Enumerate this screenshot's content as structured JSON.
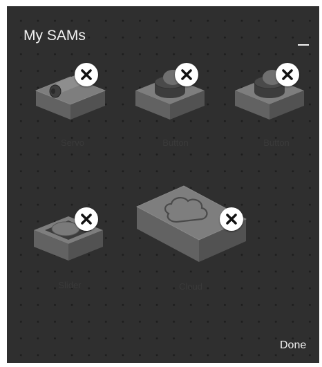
{
  "header": {
    "title": "My SAMs"
  },
  "actions": {
    "done_label": "Done"
  },
  "blocks": [
    {
      "label": "Servo",
      "icon": "servo-motor-icon"
    },
    {
      "label": "Button",
      "icon": "button-icon"
    },
    {
      "label": "Button",
      "icon": "button-icon"
    },
    {
      "label": "Slider",
      "icon": "button-icon"
    },
    {
      "label": "Cloud",
      "icon": "cloud-icon"
    }
  ],
  "colors": {
    "panel_bg": "#2f2f2f",
    "grid_dot": "#1d1d1d",
    "block_top": "#7a7a7a",
    "block_side": "#5c5c5c",
    "close_bg": "#ffffff",
    "close_x": "#111111"
  }
}
